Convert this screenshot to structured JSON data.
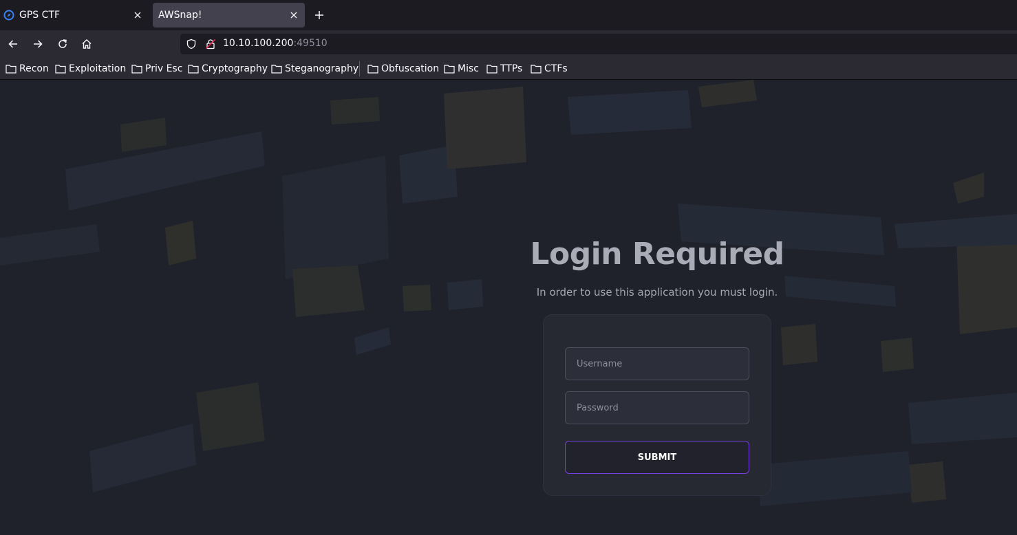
{
  "browser": {
    "tabs": [
      {
        "title": "GPS CTF",
        "active": false
      },
      {
        "title": "AWSnap!",
        "active": true
      }
    ],
    "address": {
      "host": "10.10.100.200",
      "port": ":49510"
    },
    "bookmarks": [
      {
        "label": "Recon"
      },
      {
        "label": "Exploitation"
      },
      {
        "label": "Priv Esc"
      },
      {
        "label": "Cryptography"
      },
      {
        "label": "Steganography"
      },
      {
        "label": "Obfuscation"
      },
      {
        "label": "Misc"
      },
      {
        "label": "TTPs"
      },
      {
        "label": "CTFs"
      }
    ]
  },
  "login": {
    "title": "Login Required",
    "subtitle": "In order to use this application you must login.",
    "username_placeholder": "Username",
    "password_placeholder": "Password",
    "submit_label": "SUBMIT"
  },
  "colors": {
    "accent": "#7a3fe0",
    "page_background": "#20222b",
    "card": "#262832"
  }
}
